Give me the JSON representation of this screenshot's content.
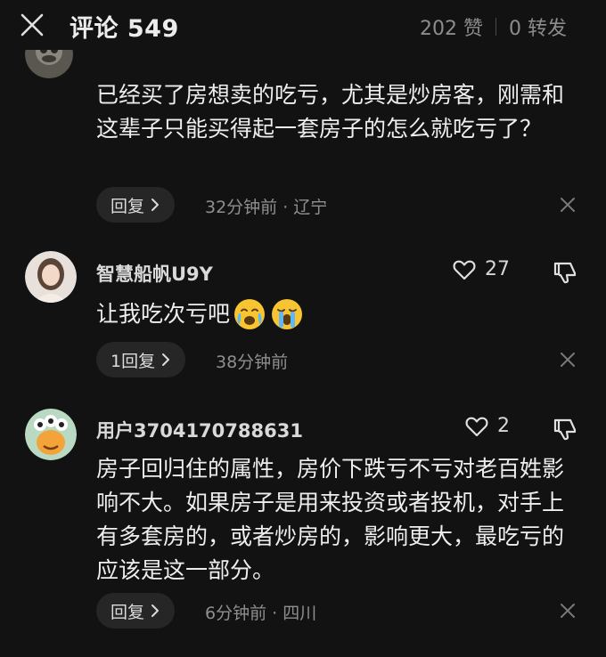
{
  "header": {
    "title": "评论 549",
    "likes": "202 赞",
    "shares": "0 转发"
  },
  "comments": [
    {
      "text": "已经买了房想卖的吃亏，尤其是炒房客，刚需和这辈子只能买得起一套房子的怎么就吃亏了？",
      "reply_label": "回复",
      "meta": "32分钟前 · 辽宁"
    },
    {
      "username": "智慧船帆U9Y",
      "like_count": "27",
      "text": "让我吃次亏吧",
      "reply_label": "1回复",
      "meta": "38分钟前"
    },
    {
      "username": "用户3704170788631",
      "like_count": "2",
      "text": "房子回归住的属性，房价下跌亏不亏对老百姓影响不大。如果房子是用来投资或者投机，对手上有多套房的，或者炒房的，影响更大，最吃亏的应该是这一部分。",
      "reply_label": "回复",
      "meta": "6分钟前 · 四川"
    }
  ]
}
